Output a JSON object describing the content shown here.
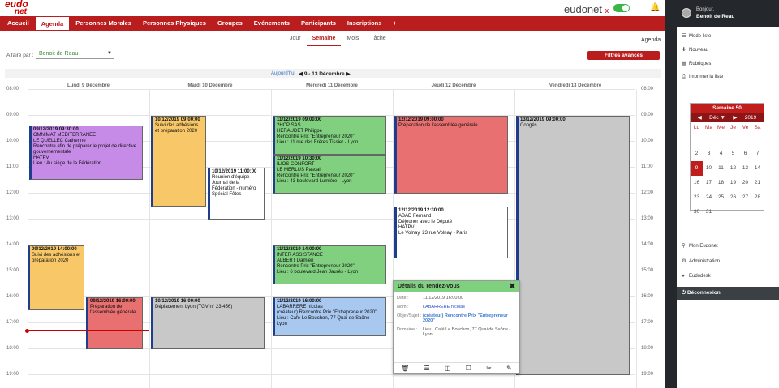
{
  "header": {
    "logo_top": "eudo",
    "logo_bottom": "net",
    "brand": "eudonet",
    "brand_mark": "x"
  },
  "nav": [
    "Accueil",
    "Agenda",
    "Personnes Morales",
    "Personnes Physiques",
    "Groupes",
    "Evénements",
    "Participants",
    "Inscriptions",
    "+"
  ],
  "nav_active": "Agenda",
  "view_tabs": [
    "Jour",
    "Semaine",
    "Mois",
    "Tâche"
  ],
  "view_active": "Semaine",
  "page_label": "Agenda",
  "filter": {
    "label": "A faire par :",
    "owner": "Benoit de Reau",
    "advanced_button": "Filtres avancés"
  },
  "week": {
    "today_link": "Aujourd'hui",
    "range": "9 - 13 Décembre"
  },
  "days": [
    "Lundi 9 Décembre",
    "Mardi 10 Décembre",
    "Mercredi 11 Décembre",
    "Jeudi 12 Décembre",
    "Vendredi 13 Décembre"
  ],
  "hours": [
    "08:00",
    "09:00",
    "10:00",
    "11:00",
    "12:00",
    "13:00",
    "14:00",
    "15:00",
    "16:00",
    "17:00",
    "18:00",
    "19:00"
  ],
  "events": [
    {
      "lines": [
        "09/12/2019 09:30:00",
        "OMNIMAT MEDITERRANEE",
        "LE QUELLEC Catherine",
        "Rencontre afin de préparer le projet de directive gouvernementale",
        "HATPV",
        "Lieu : Au siège de la Fédération"
      ],
      "color": "#c58be6"
    },
    {
      "lines": [
        "09/12/2019 14:00:00",
        "Suivi des adhésions et préparation 2020"
      ],
      "color": "#f8c868"
    },
    {
      "lines": [
        "09/12/2019 16:00:00",
        "Préparation de l'assemblée générale"
      ],
      "color": "#e87070"
    },
    {
      "lines": [
        "10/12/2019 09:00:00",
        "Suivi des adhésions et préparation 2020"
      ],
      "color": "#f8c868"
    },
    {
      "lines": [
        "10/12/2019 11:00:00",
        "Réunion d'équipe Journal de la Fédération - numéro Spécial Fêtes"
      ],
      "color": "#ffffff"
    },
    {
      "lines": [
        "10/12/2019 16:00:00",
        "Déplacement Lyon (TGV n° 23 456)"
      ],
      "color": "#c8c8c8"
    },
    {
      "lines": [
        "11/12/2019 09:00:00",
        "2HCP SAS",
        "HERAUDET Philippe",
        "Rencontre Prix \"Entrepreneur 2020\"",
        "Lieu : 11 rue des Frères Tissier - Lyon"
      ],
      "color": "#80d080"
    },
    {
      "lines": [
        "11/12/2019 10:30:00",
        "ILIOS CONFORT",
        "LE MERLUS Pascal",
        "Rencontre Prix \"Entrepreneur 2020\"",
        "Lieu : 43 boulevard Lumière - Lyon"
      ],
      "color": "#80d080"
    },
    {
      "lines": [
        "11/12/2019 14:00:00",
        "INTER ASSISTANCE",
        "ALBERT Damien",
        "Rencontre Prix \"Entrepreneur 2020\"",
        "Lieu : 6 boulevard Jean Jaurès - Lyon"
      ],
      "color": "#80d080"
    },
    {
      "lines": [
        "11/12/2019 16:00:00",
        "LABARRERE nicolas",
        "(créateur) Rencontre Prix \"Entrepreneur 2020\"",
        "Lieu : Café Le Bouchon, 77 Quai de Saône - Lyon"
      ],
      "color": "#a8c8f0"
    },
    {
      "lines": [
        "12/12/2019 09:00:00",
        "Préparation de l'assemblée générale"
      ],
      "color": "#e87070"
    },
    {
      "lines": [
        "12/12/2019 12:30:00",
        "ABAD Fernand",
        "Déjeuner avec le Député",
        "HATPV",
        "Le Volnay, 23 rue Volnay - Paris"
      ],
      "color": "#ffffff"
    },
    {
      "lines": [
        "13/12/2019 09:00:00",
        "Congés"
      ],
      "color": "#c8c8c8"
    }
  ],
  "popup": {
    "title": "Détails du rendez-vous",
    "rows": [
      {
        "k": "Date :",
        "v": "11/12/2019 16:00:00"
      },
      {
        "k": "Nom :",
        "v": "LABARRERE nicolas"
      },
      {
        "k": "Objet/Sujet :",
        "v": "(créateur) Rencontre Prix \"Entrepreneur 2020\""
      },
      {
        "k": "Domaine :",
        "v": "Lieu : Café Le Bouchon, 77 Quai de Saône - Lyon"
      }
    ]
  },
  "sidebar": {
    "greeting": "Bonjour,",
    "user": "Benoit de Reau",
    "menu": [
      "Mode liste",
      "Nouveau",
      "Rubriques",
      "Imprimer la liste"
    ],
    "week_label": "Semaine 50",
    "month": "Déc",
    "year": "2019",
    "weekday_heads": [
      "Lu",
      "Ma",
      "Me",
      "Je",
      "Ve",
      "Sa"
    ],
    "weeks": [
      [
        "",
        "",
        "",
        "",
        "",
        ""
      ],
      [
        "2",
        "3",
        "4",
        "5",
        "6",
        "7"
      ],
      [
        "9",
        "10",
        "11",
        "12",
        "13",
        "14"
      ],
      [
        "16",
        "17",
        "18",
        "19",
        "20",
        "21"
      ],
      [
        "23",
        "24",
        "25",
        "26",
        "27",
        "28"
      ],
      [
        "30",
        "31",
        "",
        "",
        "",
        ""
      ]
    ],
    "selected_day": "9",
    "bottom_menu": [
      "Mon Eudonet",
      "Administration",
      "Eudodesk"
    ],
    "logout": "Déconnexion"
  }
}
